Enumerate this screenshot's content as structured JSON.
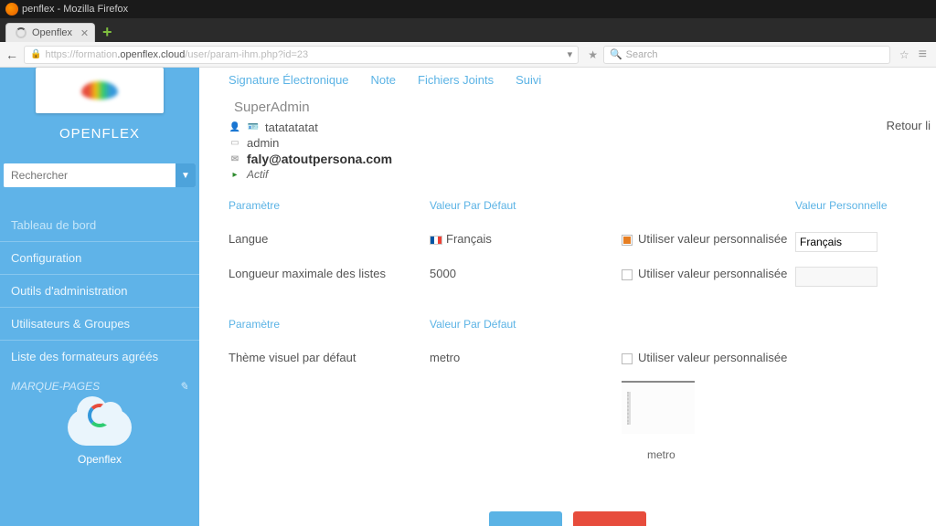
{
  "window": {
    "title": "penflex - Mozilla Firefox"
  },
  "browser": {
    "tab_label": "Openflex",
    "url_prefix": "https://formation",
    "url_host": ".openflex.cloud",
    "url_path": "/user/param-ihm.php?id=23",
    "dropdown_glyph": "▾",
    "search_placeholder": "Search",
    "search_icon": "🔍"
  },
  "sidebar": {
    "brand": "OPENFLEX",
    "search_placeholder": "Rechercher",
    "items": [
      {
        "label": "Tableau de bord"
      },
      {
        "label": "Configuration"
      },
      {
        "label": "Outils d'administration"
      },
      {
        "label": "Utilisateurs & Groupes"
      },
      {
        "label": "Liste des formateurs agréés"
      }
    ],
    "bookmarks": "MARQUE-PAGES",
    "bookmarks_icon": "✎",
    "footer_label": "Openflex"
  },
  "tabs": [
    {
      "label": "Signature Électronique"
    },
    {
      "label": "Note"
    },
    {
      "label": "Fichiers Joints"
    },
    {
      "label": "Suivi"
    }
  ],
  "user": {
    "title": "SuperAdmin",
    "fullname": "tatatatatat",
    "login": "admin",
    "email": "faly@atoutpersona.com",
    "status": "Actif",
    "back_link": "Retour li"
  },
  "columns": {
    "param": "Paramètre",
    "default": "Valeur Par Défaut",
    "personal": "Valeur Personnelle"
  },
  "params": {
    "section1": [
      {
        "name": "Langue",
        "default": "Français",
        "use_custom": true,
        "use_custom_label": "Utiliser valeur personnalisée",
        "personal": "Français"
      },
      {
        "name": "Longueur maximale des listes",
        "default": "5000",
        "use_custom": false,
        "use_custom_label": "Utiliser valeur personnalisée",
        "personal": ""
      }
    ],
    "section2": [
      {
        "name": "Thème visuel par défaut",
        "default": "metro",
        "use_custom": false,
        "use_custom_label": "Utiliser valeur personnalisée",
        "theme_caption": "metro"
      }
    ]
  }
}
